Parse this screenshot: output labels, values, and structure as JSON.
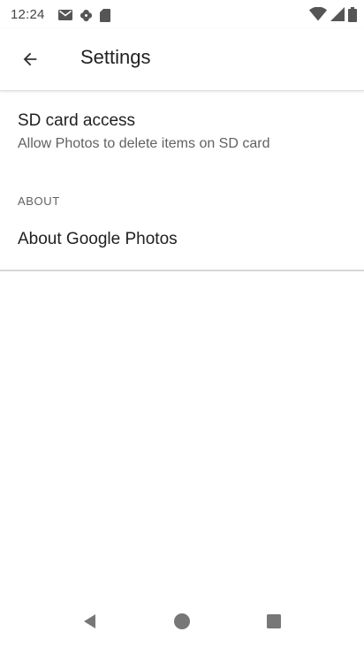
{
  "status_bar": {
    "time": "12:24",
    "left_icons": [
      "gmail-icon",
      "photos-pinwheel-icon",
      "sd-card-icon"
    ],
    "right_icons": [
      "wifi-icon",
      "cell-signal-icon",
      "battery-icon"
    ]
  },
  "app_bar": {
    "back_icon": "arrow-back-icon",
    "title": "Settings"
  },
  "settings": {
    "sd_card": {
      "title": "SD card access",
      "summary": "Allow Photos to delete items on SD card"
    },
    "about_section": {
      "header": "ABOUT",
      "item_label": "About Google Photos"
    }
  },
  "nav_bar": {
    "back": "nav-back-icon",
    "home": "nav-home-icon",
    "recents": "nav-recents-icon"
  },
  "colors": {
    "background": "#ffffff",
    "text_primary": "#212121",
    "text_secondary": "#616161",
    "icon_gray": "#555555",
    "divider": "#d6d6d6"
  }
}
